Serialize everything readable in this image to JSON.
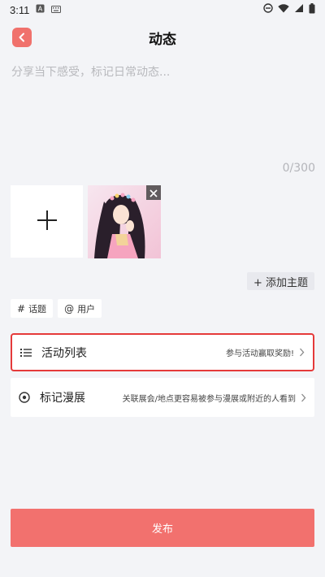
{
  "status_bar": {
    "time": "3:11",
    "left_icons": [
      "a-badge-icon",
      "keyboard-icon"
    ],
    "right_icons": [
      "do-not-disturb-icon",
      "wifi-icon",
      "signal-icon",
      "battery-icon"
    ]
  },
  "header": {
    "title": "动态",
    "back_icon": "chevron-left-icon",
    "accent_color": "#f0716c"
  },
  "composer": {
    "placeholder": "分享当下感受，标记日常动态...",
    "value": "",
    "char_count": "0/300"
  },
  "media": {
    "add_icon": "plus-icon",
    "thumbnail_icon": "photo-thumbnail",
    "remove_icon": "close-icon"
  },
  "add_topic": {
    "label": "+ 添加主题"
  },
  "tags": [
    {
      "symbol": "#",
      "label": "话题"
    },
    {
      "symbol": "@",
      "label": "用户"
    }
  ],
  "activity_row": {
    "icon": "list-icon",
    "title": "活动列表",
    "hint": "参与活动赢取奖励!",
    "highlight_color": "#e53a3a"
  },
  "expo_row": {
    "icon": "location-pin-icon",
    "title": "标记漫展",
    "hint": "关联展会/地点更容易被参与漫展或附近的人看到"
  },
  "publish": {
    "label": "发布",
    "color": "#f2716e"
  }
}
